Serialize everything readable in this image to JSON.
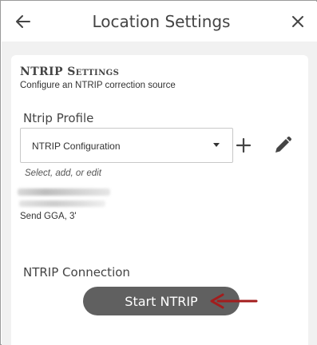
{
  "header": {
    "title": "Location Settings",
    "back_icon": "arrow-left-icon",
    "close_icon": "close-icon"
  },
  "ntrip": {
    "section_title": "NTRIP Settings",
    "section_subtitle": "Configure an NTRIP correction source",
    "profile_label": "Ntrip Profile",
    "profile_value": "NTRIP Configuration",
    "add_icon": "plus-icon",
    "edit_icon": "pencil-icon",
    "hint": "Select, add, or edit",
    "send_gga": "Send GGA, 3'",
    "connection_label": "NTRIP Connection",
    "start_button": "Start NTRIP"
  },
  "colors": {
    "annotation_arrow": "#a31d1d",
    "button_bg": "#606060",
    "content_bg": "#f1f1f1"
  }
}
